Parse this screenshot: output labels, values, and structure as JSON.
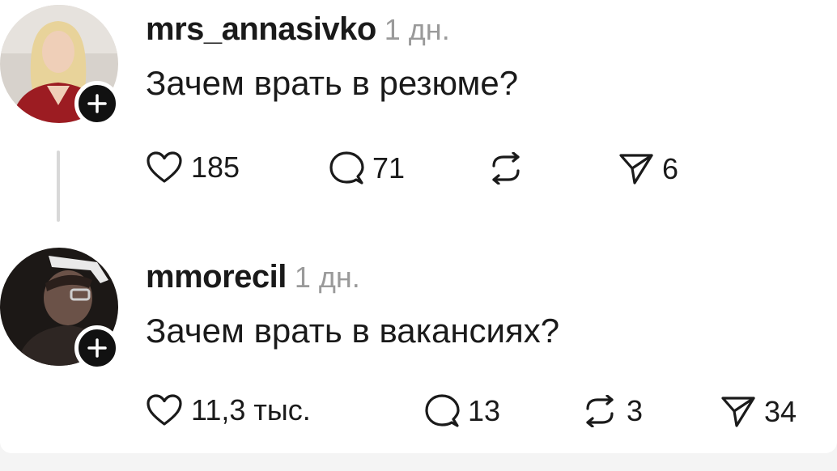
{
  "posts": [
    {
      "username": "mrs_annasivko",
      "time": "1 дн.",
      "text": "Зачем врать в резюме?",
      "actions": {
        "likes": "185",
        "comments": "71",
        "reposts": "",
        "shares": "6"
      },
      "avatar_icon": "profile-photo-woman"
    },
    {
      "username": "mmorecil",
      "time": "1 дн.",
      "text": "Зачем врать в вакансиях?",
      "actions": {
        "likes": "11,3 тыс.",
        "comments": "13",
        "reposts": "3",
        "shares": "34"
      },
      "avatar_icon": "profile-photo-man"
    }
  ],
  "colors": {
    "text": "#1a1a1a",
    "muted": "#9a9a9a",
    "badge": "#111111",
    "thread_line": "#d8d8d8"
  },
  "icons": [
    "heart-icon",
    "comment-icon",
    "repost-icon",
    "share-icon",
    "plus-icon"
  ]
}
